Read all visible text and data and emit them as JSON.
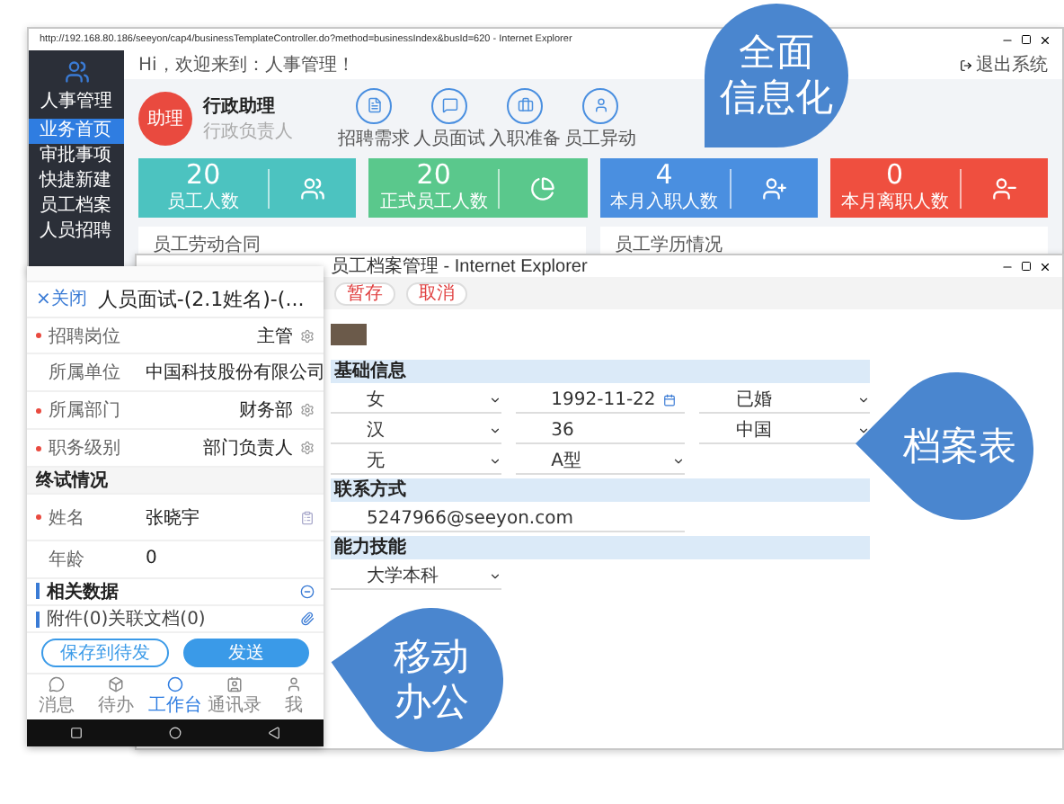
{
  "desktop_window": {
    "title": "http://192.168.80.186/seeyon/cap4/businessTemplateController.do?method=businessIndex&busId=620 - Internet Explorer",
    "sidebar": {
      "app_name": "人事管理",
      "items": [
        {
          "label": "业务首页",
          "selected": true
        },
        {
          "label": "审批事项",
          "selected": false
        },
        {
          "label": "快捷新建",
          "selected": false
        },
        {
          "label": "员工档案",
          "selected": false
        },
        {
          "label": "人员招聘",
          "selected": false
        }
      ]
    },
    "greeting": "Hi，欢迎来到：人事管理！",
    "logout": "退出系统",
    "profile": {
      "badge": "助理",
      "name": "行政助理",
      "role": "行政负责人"
    },
    "shortcuts": [
      {
        "label": "招聘需求"
      },
      {
        "label": "人员面试"
      },
      {
        "label": "入职准备"
      },
      {
        "label": "员工异动"
      }
    ],
    "stats": [
      {
        "value": "20",
        "label": "员工人数",
        "color": "#4cc3c0",
        "kind": "users"
      },
      {
        "value": "20",
        "label": "正式员工人数",
        "color": "#5ac88c",
        "kind": "pie"
      },
      {
        "value": "4",
        "label": "本月入职人数",
        "color": "#4a8fe0",
        "kind": "join"
      },
      {
        "value": "0",
        "label": "本月离职人数",
        "color": "#ef4f3f",
        "kind": "leave"
      }
    ],
    "panels": [
      {
        "title": "员工劳动合同"
      },
      {
        "title": "员工学历情况"
      }
    ]
  },
  "archive_window": {
    "title": "员工档案管理 - Internet Explorer",
    "toolbar": [
      "暂存",
      "取消"
    ],
    "sections": [
      {
        "title": "基础信息",
        "fields": [
          {
            "value": "女",
            "kind": "select"
          },
          {
            "value": "1992-11-22",
            "kind": "date"
          },
          {
            "value": "已婚",
            "kind": "select"
          },
          {
            "value": "汉",
            "kind": "select"
          },
          {
            "value": "36",
            "kind": "text"
          },
          {
            "value": "中国",
            "kind": "select"
          },
          {
            "value": "无",
            "kind": "select"
          },
          {
            "value": "A型",
            "kind": "select"
          }
        ]
      },
      {
        "title": "联系方式",
        "fields": [
          {
            "value": "5247966@seeyon.com",
            "kind": "text"
          }
        ]
      },
      {
        "title": "能力技能",
        "fields": [
          {
            "value": "大学本科",
            "kind": "select"
          }
        ]
      }
    ]
  },
  "mobile": {
    "close": "×关闭",
    "title": "人员面试-(2.1姓名)-(...",
    "rows": [
      {
        "kind": "select",
        "required": true,
        "label": "招聘岗位",
        "value": "主管"
      },
      {
        "kind": "text",
        "required": false,
        "label": "所属单位",
        "value": "中国科技股份有限公司"
      },
      {
        "kind": "select",
        "required": true,
        "label": "所属部门",
        "value": "财务部"
      },
      {
        "kind": "select",
        "required": true,
        "label": "职务级别",
        "value": "部门负责人"
      },
      {
        "kind": "section",
        "label": "终试情况"
      },
      {
        "kind": "lookup",
        "required": true,
        "label": "姓名",
        "value": "张晓宇"
      },
      {
        "kind": "text",
        "required": false,
        "label": "年龄",
        "value": "0"
      },
      {
        "kind": "group",
        "label": "相关数据"
      },
      {
        "kind": "attach",
        "label": "附件(0)关联文档(0)"
      }
    ],
    "buttons": [
      {
        "label": "保存到待发",
        "primary": false
      },
      {
        "label": "发送",
        "primary": true
      }
    ],
    "tabs": [
      {
        "label": "消息",
        "selected": false
      },
      {
        "label": "待办",
        "selected": false
      },
      {
        "label": "工作台",
        "selected": true
      },
      {
        "label": "通讯录",
        "selected": false
      },
      {
        "label": "我",
        "selected": false
      }
    ]
  },
  "callouts": [
    {
      "lines": [
        "全面",
        "信息化"
      ]
    },
    {
      "lines": [
        "档案表"
      ]
    },
    {
      "lines": [
        "移动",
        "办公"
      ]
    }
  ]
}
